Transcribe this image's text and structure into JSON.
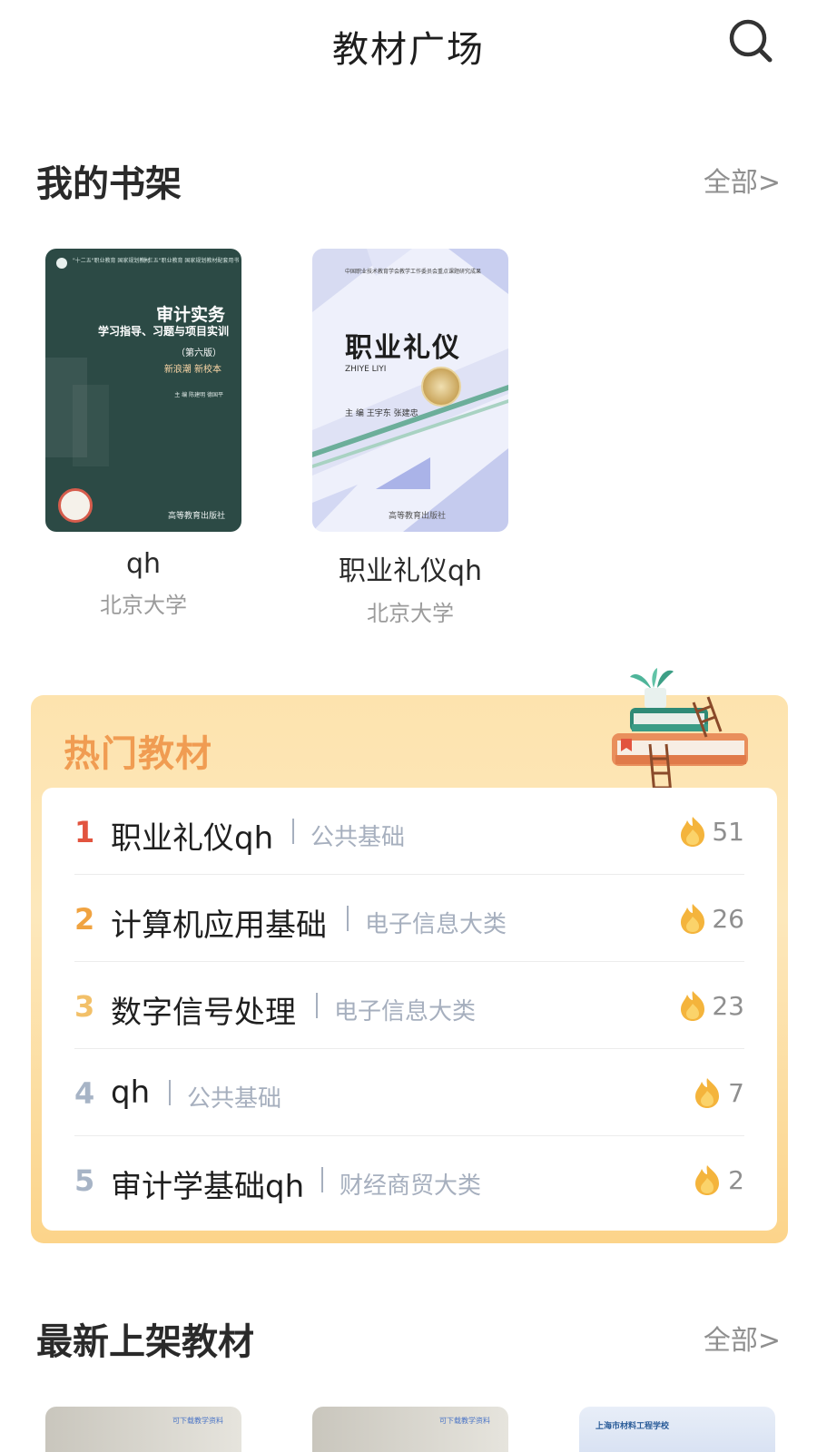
{
  "header": {
    "title": "教材广场",
    "search_icon": "search-icon"
  },
  "shelf": {
    "title": "我的书架",
    "more": "全部>",
    "books": [
      {
        "name": "qh",
        "school": "北京大学",
        "cover": {
          "top_left": "\"十二五\"职业教育 国家规划教材",
          "top_right": "\"十三五\"职业教育 国家规划教材配套用书",
          "title": "审计实务",
          "subtitle": "学习指导、习题与项目实训",
          "edition": "（第六版）",
          "authors": "新浪潮 新校本",
          "editors": "主 编 陈建明 德国平",
          "seal_text": "新形态 教材",
          "publisher": "高等教育出版社"
        }
      },
      {
        "name": "职业礼仪qh",
        "school": "北京大学",
        "cover": {
          "top": "中国职业技术教育学会教学工作委员会重点课题研究成果",
          "title": "职业礼仪",
          "pinyin": "ZHIYE LIYI",
          "editors": "主 编 王宇东 张建忠",
          "seal_text": "新形态 教材",
          "publisher": "高等教育出版社"
        }
      }
    ]
  },
  "hot": {
    "title": "热门教材",
    "items": [
      {
        "rank": "1",
        "title": "职业礼仪qh",
        "category": "公共基础",
        "count": "51",
        "rank_color": "#e2543f"
      },
      {
        "rank": "2",
        "title": "计算机应用基础",
        "category": "电子信息大类",
        "count": "26",
        "rank_color": "#f0a341"
      },
      {
        "rank": "3",
        "title": "数字信号处理",
        "category": "电子信息大类",
        "count": "23",
        "rank_color": "#f2c069"
      },
      {
        "rank": "4",
        "title": "qh",
        "category": "公共基础",
        "count": "7",
        "rank_color": "#a7b4c6"
      },
      {
        "rank": "5",
        "title": "审计学基础qh",
        "category": "财经商贸大类",
        "count": "2",
        "rank_color": "#a7b4c6"
      }
    ]
  },
  "latest": {
    "title": "最新上架教材",
    "more": "全部>",
    "thumbs": [
      {
        "label": "可下载教学资料"
      },
      {
        "label": "可下载教学资料"
      },
      {
        "label": "上海市材料工程学校"
      }
    ]
  }
}
